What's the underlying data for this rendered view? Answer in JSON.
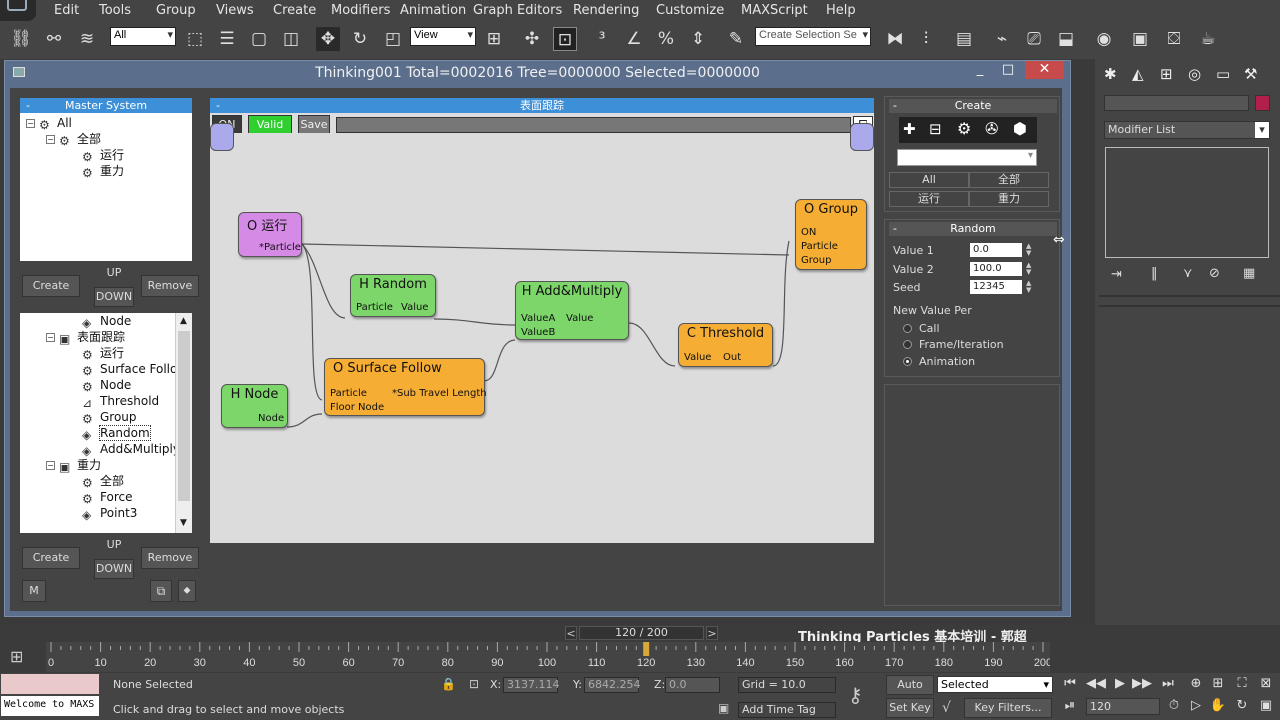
{
  "menu": [
    "Edit",
    "Tools",
    "Group",
    "Views",
    "Create",
    "Modifiers",
    "Animation",
    "Graph Editors",
    "Rendering",
    "Customize",
    "MAXScript",
    "Help"
  ],
  "toolbar": {
    "selection_filter": "All",
    "ref_coord": "View",
    "named_selection": "Create Selection Se"
  },
  "tp_window": {
    "title": "Thinking001  Total=0002016  Tree=0000000  Selected=0000000",
    "min": "_",
    "max": "□",
    "close": "✕"
  },
  "master_system": {
    "header": "Master System",
    "collapse": "-",
    "tree": [
      {
        "label": "All",
        "toggle": "−",
        "level": 0
      },
      {
        "label": "全部",
        "toggle": "−",
        "level": 1
      },
      {
        "label": "运行",
        "level": 2
      },
      {
        "label": "重力",
        "level": 2
      }
    ],
    "create": "Create",
    "up": "UP",
    "down": "DOWN",
    "remove": "Remove"
  },
  "dynset_tree": [
    {
      "label": "Node",
      "level": 2,
      "icon": "node"
    },
    {
      "label": "表面跟踪",
      "level": 1,
      "toggle": "−",
      "icon": "group"
    },
    {
      "label": "运行",
      "level": 2,
      "icon": "gear"
    },
    {
      "label": "Surface Follow",
      "level": 2,
      "icon": "gear"
    },
    {
      "label": "Node",
      "level": 2,
      "icon": "gear"
    },
    {
      "label": "Threshold",
      "level": 2,
      "icon": "threshold"
    },
    {
      "label": "Group",
      "level": 2,
      "icon": "gear"
    },
    {
      "label": "Random",
      "level": 2,
      "icon": "node",
      "selected": true
    },
    {
      "label": "Add&Multiply",
      "level": 2,
      "icon": "node"
    },
    {
      "label": "重力",
      "level": 1,
      "toggle": "−",
      "icon": "group"
    },
    {
      "label": "全部",
      "level": 2,
      "icon": "gear"
    },
    {
      "label": "Force",
      "level": 2,
      "icon": "gear"
    },
    {
      "label": "Point3",
      "level": 2,
      "icon": "node"
    }
  ],
  "lower_buttons": {
    "create": "Create",
    "up": "UP",
    "down": "DOWN",
    "remove": "Remove",
    "m": "M"
  },
  "graph": {
    "header": "表面跟踪",
    "collapse": "-",
    "on": "ON",
    "valid": "Valid",
    "save": "Save",
    "nodes": {
      "run": {
        "title": "O 运行",
        "port": "*Particle"
      },
      "random": {
        "title": "H Random",
        "in": "Particle",
        "out": "Value"
      },
      "addmul": {
        "title": "H Add&Multiply",
        "in1": "ValueA",
        "in2": "ValueB",
        "out": "Value"
      },
      "threshold": {
        "title": "C Threshold",
        "in": "Value",
        "out": "Out"
      },
      "group": {
        "title": "O Group",
        "p1": "ON",
        "p2": "Particle",
        "p3": "Group"
      },
      "surface": {
        "title": "O Surface Follow",
        "in1": "Particle",
        "in2": "Floor Node",
        "out": "*Sub Travel Length"
      },
      "hnode": {
        "title": "H Node",
        "out": "Node"
      }
    }
  },
  "create_panel": {
    "header": "Create",
    "collapse": "-",
    "tabs": [
      "All",
      "全部",
      "运行",
      "重力"
    ]
  },
  "random_panel": {
    "header": "Random",
    "collapse": "-",
    "value1_label": "Value 1",
    "value1": "0.0",
    "value2_label": "Value 2",
    "value2": "100.0",
    "seed_label": "Seed",
    "seed": "12345",
    "new_value_per": "New Value Per",
    "options": [
      "Call",
      "Frame/Iteration",
      "Animation"
    ],
    "selected_option": "Animation"
  },
  "command_panel": {
    "modifier_list": "Modifier List",
    "accent": "#b0204a"
  },
  "timeline": {
    "frame": "120 / 200",
    "prev": "<",
    "next": ">",
    "watermark": "Thinking Particles 基本培训 - 郭超",
    "ticks": [
      "0",
      "10",
      "20",
      "30",
      "40",
      "50",
      "60",
      "70",
      "80",
      "90",
      "100",
      "110",
      "120",
      "130",
      "140",
      "150",
      "160",
      "170",
      "180",
      "190",
      "200"
    ],
    "current": 120,
    "total": 200
  },
  "status": {
    "maxscript": "Welcome to MAXS",
    "selection": "None Selected",
    "prompt": "Click and drag to select and move objects",
    "x_label": "X:",
    "x": "3137.114",
    "y_label": "Y:",
    "y": "6842.254",
    "z_label": "Z:",
    "z": "0.0",
    "grid": "Grid = 10.0",
    "add_time_tag": "Add Time Tag",
    "auto_key": "Auto Key",
    "set_key": "Set Key",
    "key_mode": "Selected",
    "key_filters": "Key Filters...",
    "frame_field": "120"
  }
}
